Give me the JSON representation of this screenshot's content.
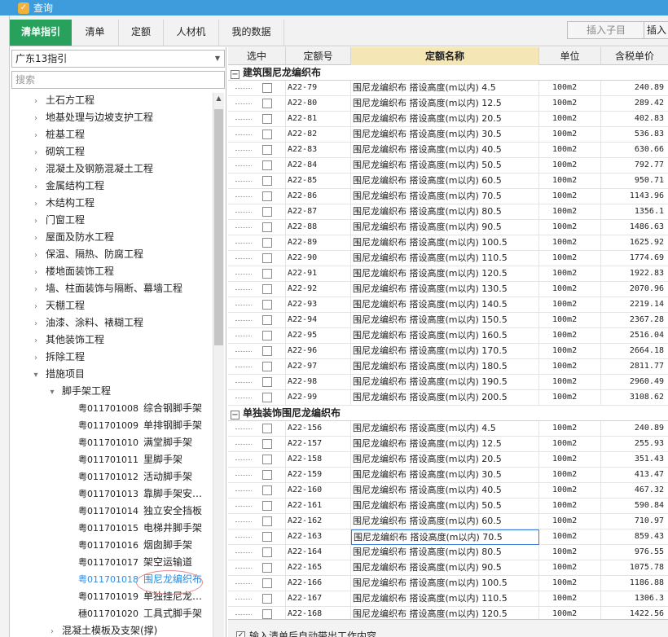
{
  "window": {
    "title": "查询"
  },
  "tabs": [
    {
      "label": "清单指引",
      "active": true
    },
    {
      "label": "清单"
    },
    {
      "label": "定额"
    },
    {
      "label": "人材机"
    },
    {
      "label": "我的数据"
    }
  ],
  "toolbar": {
    "insert_child": "插入子目",
    "insert": "插入"
  },
  "left": {
    "library": "广东13指引",
    "search_placeholder": "搜索",
    "tree": [
      {
        "label": "土石方工程",
        "level": 1,
        "expanded": false
      },
      {
        "label": "地基处理与边坡支护工程",
        "level": 1,
        "expanded": false
      },
      {
        "label": "桩基工程",
        "level": 1,
        "expanded": false
      },
      {
        "label": "砌筑工程",
        "level": 1,
        "expanded": false
      },
      {
        "label": "混凝土及钢筋混凝土工程",
        "level": 1,
        "expanded": false
      },
      {
        "label": "金属结构工程",
        "level": 1,
        "expanded": false
      },
      {
        "label": "木结构工程",
        "level": 1,
        "expanded": false
      },
      {
        "label": "门窗工程",
        "level": 1,
        "expanded": false
      },
      {
        "label": "屋面及防水工程",
        "level": 1,
        "expanded": false
      },
      {
        "label": "保温、隔热、防腐工程",
        "level": 1,
        "expanded": false
      },
      {
        "label": "楼地面装饰工程",
        "level": 1,
        "expanded": false
      },
      {
        "label": "墙、柱面装饰与隔断、幕墙工程",
        "level": 1,
        "expanded": false
      },
      {
        "label": "天棚工程",
        "level": 1,
        "expanded": false
      },
      {
        "label": "油漆、涂料、裱糊工程",
        "level": 1,
        "expanded": false
      },
      {
        "label": "其他装饰工程",
        "level": 1,
        "expanded": false
      },
      {
        "label": "拆除工程",
        "level": 1,
        "expanded": false
      },
      {
        "label": "措施项目",
        "level": 1,
        "expanded": true
      },
      {
        "label": "脚手架工程",
        "level": 2,
        "expanded": true
      },
      {
        "code": "粤011701008",
        "label": "综合钢脚手架",
        "level": 3
      },
      {
        "code": "粤011701009",
        "label": "单排钢脚手架",
        "level": 3
      },
      {
        "code": "粤011701010",
        "label": "满堂脚手架",
        "level": 3
      },
      {
        "code": "粤011701011",
        "label": "里脚手架",
        "level": 3
      },
      {
        "code": "粤011701012",
        "label": "活动脚手架",
        "level": 3
      },
      {
        "code": "粤011701013",
        "label": "靠脚手架安…",
        "level": 3
      },
      {
        "code": "粤011701014",
        "label": "独立安全挡板",
        "level": 3
      },
      {
        "code": "粤011701015",
        "label": "电梯井脚手架",
        "level": 3
      },
      {
        "code": "粤011701016",
        "label": "烟囱脚手架",
        "level": 3
      },
      {
        "code": "粤011701017",
        "label": "架空运输道",
        "level": 3
      },
      {
        "code": "粤011701018",
        "label": "围尼龙编织布",
        "level": 3,
        "selected": true
      },
      {
        "code": "粤011701019",
        "label": "单独挂尼龙…",
        "level": 3
      },
      {
        "code": "穗011701020",
        "label": "工具式脚手架",
        "level": 3
      },
      {
        "label": "混凝土模板及支架(撑)",
        "level": 2,
        "expanded": false
      }
    ]
  },
  "grid": {
    "columns": [
      "选中",
      "定额号",
      "定额名称",
      "单位",
      "含税单价"
    ],
    "groups": [
      {
        "title": "建筑围尼龙编织布",
        "rows": [
          {
            "code": "A22-79",
            "name": "围尼龙编织布 搭设高度(m以内) 4.5",
            "unit": "100m2",
            "price": "240.89"
          },
          {
            "code": "A22-80",
            "name": "围尼龙编织布 搭设高度(m以内) 12.5",
            "unit": "100m2",
            "price": "289.42"
          },
          {
            "code": "A22-81",
            "name": "围尼龙编织布 搭设高度(m以内) 20.5",
            "unit": "100m2",
            "price": "402.83"
          },
          {
            "code": "A22-82",
            "name": "围尼龙编织布 搭设高度(m以内) 30.5",
            "unit": "100m2",
            "price": "536.83"
          },
          {
            "code": "A22-83",
            "name": "围尼龙编织布 搭设高度(m以内) 40.5",
            "unit": "100m2",
            "price": "630.66"
          },
          {
            "code": "A22-84",
            "name": "围尼龙编织布 搭设高度(m以内) 50.5",
            "unit": "100m2",
            "price": "792.77"
          },
          {
            "code": "A22-85",
            "name": "围尼龙编织布 搭设高度(m以内) 60.5",
            "unit": "100m2",
            "price": "950.71"
          },
          {
            "code": "A22-86",
            "name": "围尼龙编织布 搭设高度(m以内) 70.5",
            "unit": "100m2",
            "price": "1143.96"
          },
          {
            "code": "A22-87",
            "name": "围尼龙编织布 搭设高度(m以内) 80.5",
            "unit": "100m2",
            "price": "1356.1"
          },
          {
            "code": "A22-88",
            "name": "围尼龙编织布 搭设高度(m以内) 90.5",
            "unit": "100m2",
            "price": "1486.63"
          },
          {
            "code": "A22-89",
            "name": "围尼龙编织布 搭设高度(m以内) 100.5",
            "unit": "100m2",
            "price": "1625.92"
          },
          {
            "code": "A22-90",
            "name": "围尼龙编织布 搭设高度(m以内) 110.5",
            "unit": "100m2",
            "price": "1774.69"
          },
          {
            "code": "A22-91",
            "name": "围尼龙编织布 搭设高度(m以内) 120.5",
            "unit": "100m2",
            "price": "1922.83"
          },
          {
            "code": "A22-92",
            "name": "围尼龙编织布 搭设高度(m以内) 130.5",
            "unit": "100m2",
            "price": "2070.96"
          },
          {
            "code": "A22-93",
            "name": "围尼龙编织布 搭设高度(m以内) 140.5",
            "unit": "100m2",
            "price": "2219.14"
          },
          {
            "code": "A22-94",
            "name": "围尼龙编织布 搭设高度(m以内) 150.5",
            "unit": "100m2",
            "price": "2367.28"
          },
          {
            "code": "A22-95",
            "name": "围尼龙编织布 搭设高度(m以内) 160.5",
            "unit": "100m2",
            "price": "2516.04"
          },
          {
            "code": "A22-96",
            "name": "围尼龙编织布 搭设高度(m以内) 170.5",
            "unit": "100m2",
            "price": "2664.18"
          },
          {
            "code": "A22-97",
            "name": "围尼龙编织布 搭设高度(m以内) 180.5",
            "unit": "100m2",
            "price": "2811.77"
          },
          {
            "code": "A22-98",
            "name": "围尼龙编织布 搭设高度(m以内) 190.5",
            "unit": "100m2",
            "price": "2960.49"
          },
          {
            "code": "A22-99",
            "name": "围尼龙编织布 搭设高度(m以内) 200.5",
            "unit": "100m2",
            "price": "3108.62"
          }
        ]
      },
      {
        "title": "单独装饰围尼龙编织布",
        "rows": [
          {
            "code": "A22-156",
            "name": "围尼龙编织布 搭设高度(m以内) 4.5",
            "unit": "100m2",
            "price": "240.89"
          },
          {
            "code": "A22-157",
            "name": "围尼龙编织布 搭设高度(m以内) 12.5",
            "unit": "100m2",
            "price": "255.93"
          },
          {
            "code": "A22-158",
            "name": "围尼龙编织布 搭设高度(m以内) 20.5",
            "unit": "100m2",
            "price": "351.43"
          },
          {
            "code": "A22-159",
            "name": "围尼龙编织布 搭设高度(m以内) 30.5",
            "unit": "100m2",
            "price": "413.47"
          },
          {
            "code": "A22-160",
            "name": "围尼龙编织布 搭设高度(m以内) 40.5",
            "unit": "100m2",
            "price": "467.32"
          },
          {
            "code": "A22-161",
            "name": "围尼龙编织布 搭设高度(m以内) 50.5",
            "unit": "100m2",
            "price": "590.84"
          },
          {
            "code": "A22-162",
            "name": "围尼龙编织布 搭设高度(m以内) 60.5",
            "unit": "100m2",
            "price": "710.97"
          },
          {
            "code": "A22-163",
            "name": "围尼龙编织布 搭设高度(m以内) 70.5",
            "unit": "100m2",
            "price": "859.43",
            "focused": true
          },
          {
            "code": "A22-164",
            "name": "围尼龙编织布 搭设高度(m以内) 80.5",
            "unit": "100m2",
            "price": "976.55"
          },
          {
            "code": "A22-165",
            "name": "围尼龙编织布 搭设高度(m以内) 90.5",
            "unit": "100m2",
            "price": "1075.78"
          },
          {
            "code": "A22-166",
            "name": "围尼龙编织布 搭设高度(m以内) 100.5",
            "unit": "100m2",
            "price": "1186.88"
          },
          {
            "code": "A22-167",
            "name": "围尼龙编织布 搭设高度(m以内) 110.5",
            "unit": "100m2",
            "price": "1306.3"
          },
          {
            "code": "A22-168",
            "name": "围尼龙编织布 搭设高度(m以内) 120.5",
            "unit": "100m2",
            "price": "1422.56"
          }
        ]
      }
    ]
  },
  "bottom": {
    "auto_bring_label": "输入清单后自动带出工作内容",
    "checked": true
  },
  "colors": {
    "titlebar": "#3f9cdc",
    "active_tab": "#27a15c",
    "selected_text": "#2f8ce0",
    "header_highlight": "#f5e7b5"
  }
}
